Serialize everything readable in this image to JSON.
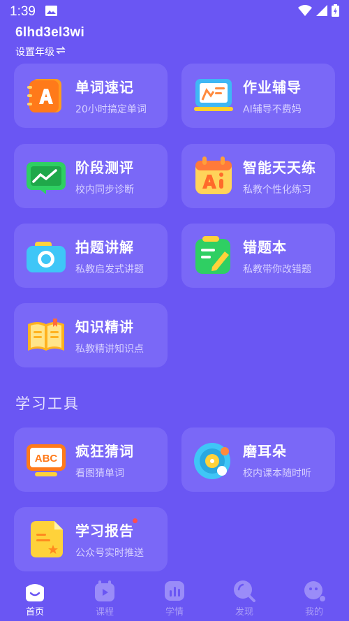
{
  "status": {
    "time": "1:39"
  },
  "header": {
    "username": "6lhd3el3wi",
    "grade_label": "设置年级",
    "grade_icon": "swap-icon"
  },
  "cards": [
    {
      "title": "单词速记",
      "sub": "20小时搞定单词",
      "icon": "word-book-icon"
    },
    {
      "title": "作业辅导",
      "sub": "AI辅导不费妈",
      "icon": "homework-board-icon"
    },
    {
      "title": "阶段测评",
      "sub": "校内同步诊断",
      "icon": "chart-monitor-icon"
    },
    {
      "title": "智能天天练",
      "sub": "私教个性化练习",
      "icon": "ai-calendar-icon"
    },
    {
      "title": "拍题讲解",
      "sub": "私教启发式讲题",
      "icon": "camera-icon"
    },
    {
      "title": "错题本",
      "sub": "私教带你改错题",
      "icon": "notebook-pen-icon"
    },
    {
      "title": "知识精讲",
      "sub": "私教精讲知识点",
      "icon": "open-book-icon"
    }
  ],
  "tools_section": {
    "title": "学习工具"
  },
  "tools": [
    {
      "title": "疯狂猜词",
      "sub": "看图猜单词",
      "icon": "abc-screen-icon"
    },
    {
      "title": "磨耳朵",
      "sub": "校内课本随时听",
      "icon": "vinyl-record-icon"
    },
    {
      "title": "学习报告",
      "sub": "公众号实时推送",
      "icon": "report-doc-icon",
      "badge": true
    }
  ],
  "nav": [
    {
      "label": "首页",
      "icon": "home-icon",
      "active": true
    },
    {
      "label": "课程",
      "icon": "course-icon",
      "active": false
    },
    {
      "label": "学情",
      "icon": "stats-icon",
      "active": false
    },
    {
      "label": "发现",
      "icon": "discover-icon",
      "active": false
    },
    {
      "label": "我的",
      "icon": "profile-icon",
      "active": false
    }
  ],
  "colors": {
    "background": "#6a56f3",
    "card": "#7a68f7",
    "badge": "#ff4d4f"
  }
}
